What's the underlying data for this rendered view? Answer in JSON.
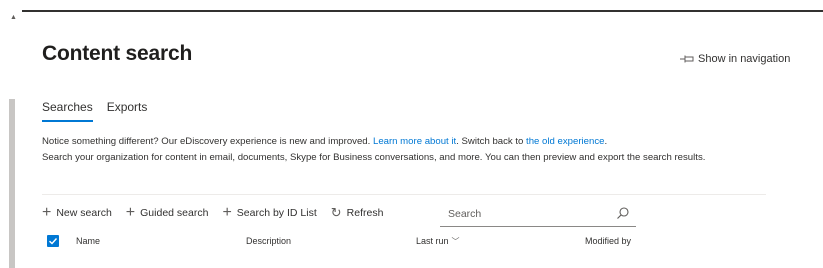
{
  "page": {
    "title": "Content search",
    "show_in_navigation": "Show in navigation"
  },
  "tabs": [
    {
      "label": "Searches",
      "active": true
    },
    {
      "label": "Exports",
      "active": false
    }
  ],
  "notice": {
    "line1_prefix": "Notice something different? Our eDiscovery experience is new and improved. ",
    "learn_more": "Learn more about it",
    "line1_mid": ". Switch back to ",
    "old_experience": "the old experience",
    "line1_suffix": ".",
    "line2": "Search your organization for content in email, documents, Skype for Business conversations, and more. You can then preview and export the search results."
  },
  "toolbar": {
    "new_search": "New search",
    "guided_search": "Guided search",
    "search_by_id": "Search by ID List",
    "refresh": "Refresh",
    "search_placeholder": "Search"
  },
  "table": {
    "columns": [
      "Name",
      "Description",
      "Last run",
      "Modified by"
    ],
    "select_all_checked": true
  },
  "colors": {
    "accent": "#0078d4",
    "text": "#323130",
    "divider": "#edebe9"
  }
}
